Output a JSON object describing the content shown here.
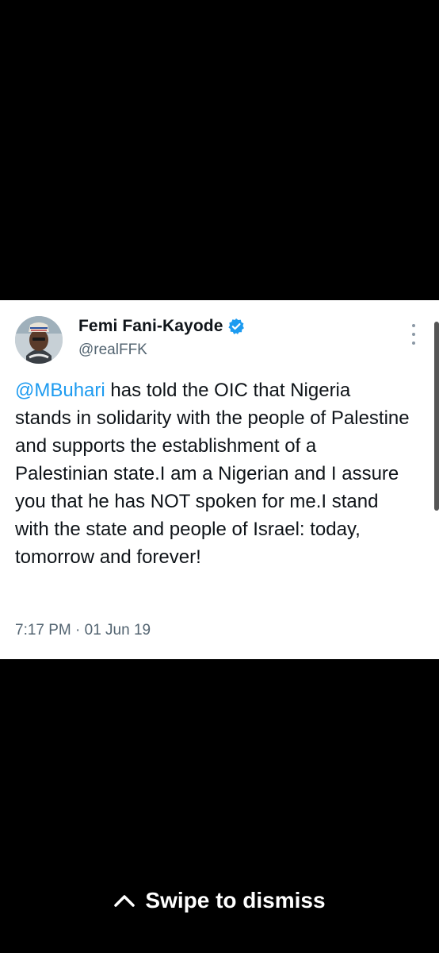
{
  "tweet": {
    "display_name": "Femi Fani-Kayode",
    "handle": "@realFFK",
    "verified": true,
    "mention": "@MBuhari",
    "text_line1_rest": " has told the OIC that",
    "text_rest": "Nigeria stands in solidarity with the people of Palestine and supports the establishment of a Palestinian state.I am a Nigerian and I assure you that he has NOT spoken for me.I stand with the state and people of Israel: today, tomorrow and forever!",
    "timestamp": "7:17 PM · 01 Jun 19"
  },
  "overlay": {
    "swipe_label": "Swipe to dismiss"
  },
  "colors": {
    "background": "#000000",
    "card": "#ffffff",
    "mention": "#1d9bf0",
    "verified": "#1d9bf0",
    "secondary_text": "#536471"
  },
  "icons": {
    "verified": "verified-badge-icon",
    "more": "more-options-icon",
    "chevron": "chevron-up-icon"
  }
}
